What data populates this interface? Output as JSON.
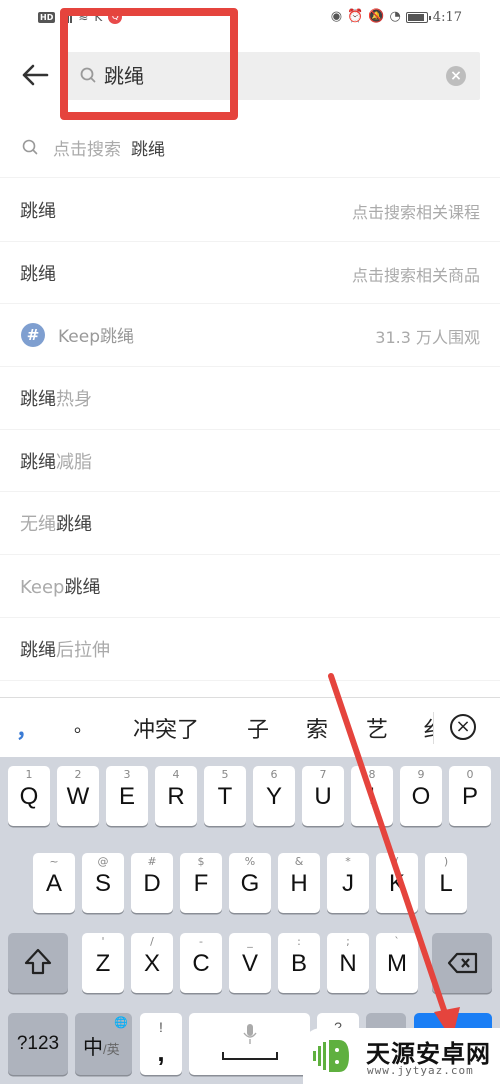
{
  "status_bar": {
    "hd_label": "HD",
    "time": "4:17",
    "left_icons": [
      "hd-icon",
      "signal-icon",
      "wifi-icon",
      "k-app-icon",
      "search-app-notification-icon"
    ],
    "right_icons": [
      "eye-comfort-icon",
      "alarm-icon",
      "mute-icon",
      "speed-icon",
      "battery-icon"
    ],
    "battery_level": 0.9
  },
  "search": {
    "query": "跳绳",
    "back_icon": "arrow-left-icon",
    "search_icon": "search-icon",
    "clear_icon": "clear-icon"
  },
  "suggestion_top": {
    "prefix": "点击搜索",
    "keyword": "跳绳"
  },
  "suggestions": [
    {
      "type": "plain",
      "highlight": "跳绳",
      "rest": "",
      "right": "点击搜索相关课程"
    },
    {
      "type": "plain",
      "highlight": "跳绳",
      "rest": "",
      "right": "点击搜索相关商品"
    },
    {
      "type": "topic",
      "pre": "Keep",
      "highlight": "跳绳",
      "right": "31.3 万人围观"
    },
    {
      "type": "plain",
      "highlight": "跳绳",
      "rest": "热身",
      "right": ""
    },
    {
      "type": "plain",
      "highlight": "跳绳",
      "rest": "减脂",
      "right": ""
    },
    {
      "type": "prefix",
      "pre": "无绳",
      "highlight": "跳绳",
      "right": ""
    },
    {
      "type": "prefix",
      "pre": "Keep",
      "highlight": "跳绳",
      "right": ""
    },
    {
      "type": "plain",
      "highlight": "跳绳",
      "rest": "后拉伸",
      "right": ""
    }
  ],
  "candidates": {
    "items": [
      "，",
      "。",
      "冲突了",
      "子",
      "索",
      "艺",
      "纟"
    ],
    "delete_icon": "close-circle-icon"
  },
  "keyboard": {
    "row1": [
      {
        "sub": "1",
        "key": "Q"
      },
      {
        "sub": "2",
        "key": "W"
      },
      {
        "sub": "3",
        "key": "E"
      },
      {
        "sub": "4",
        "key": "R"
      },
      {
        "sub": "5",
        "key": "T"
      },
      {
        "sub": "6",
        "key": "Y"
      },
      {
        "sub": "7",
        "key": "U"
      },
      {
        "sub": "8",
        "key": "I"
      },
      {
        "sub": "9",
        "key": "O"
      },
      {
        "sub": "0",
        "key": "P"
      }
    ],
    "row2": [
      {
        "sub": "~",
        "key": "A"
      },
      {
        "sub": "@",
        "key": "S"
      },
      {
        "sub": "#",
        "key": "D"
      },
      {
        "sub": "$",
        "key": "F"
      },
      {
        "sub": "%",
        "key": "G"
      },
      {
        "sub": "&",
        "key": "H"
      },
      {
        "sub": "*",
        "key": "J"
      },
      {
        "sub": "(",
        "key": "K"
      },
      {
        "sub": ")",
        "key": "L"
      }
    ],
    "row3": [
      {
        "sub": "'",
        "key": "Z"
      },
      {
        "sub": "/",
        "key": "X"
      },
      {
        "sub": "-",
        "key": "C"
      },
      {
        "sub": "_",
        "key": "V"
      },
      {
        "sub": ":",
        "key": "B"
      },
      {
        "sub": ";",
        "key": "N"
      },
      {
        "sub": "`",
        "key": "M"
      }
    ],
    "shift_icon": "shift-icon",
    "backspace_icon": "backspace-icon",
    "numbers_label": "?123",
    "lang_main": "中",
    "lang_sub": "/英",
    "globe_icon": "globe-icon",
    "comma_sub": "!",
    "comma_main": ",",
    "mic_icon": "microphone-icon",
    "question_sub": "?",
    "accent_color": "#1a7ef5"
  },
  "annotation": {
    "color": "#e5443d"
  },
  "watermark": {
    "name": "天源安卓网",
    "url": "www.jytyaz.com"
  }
}
